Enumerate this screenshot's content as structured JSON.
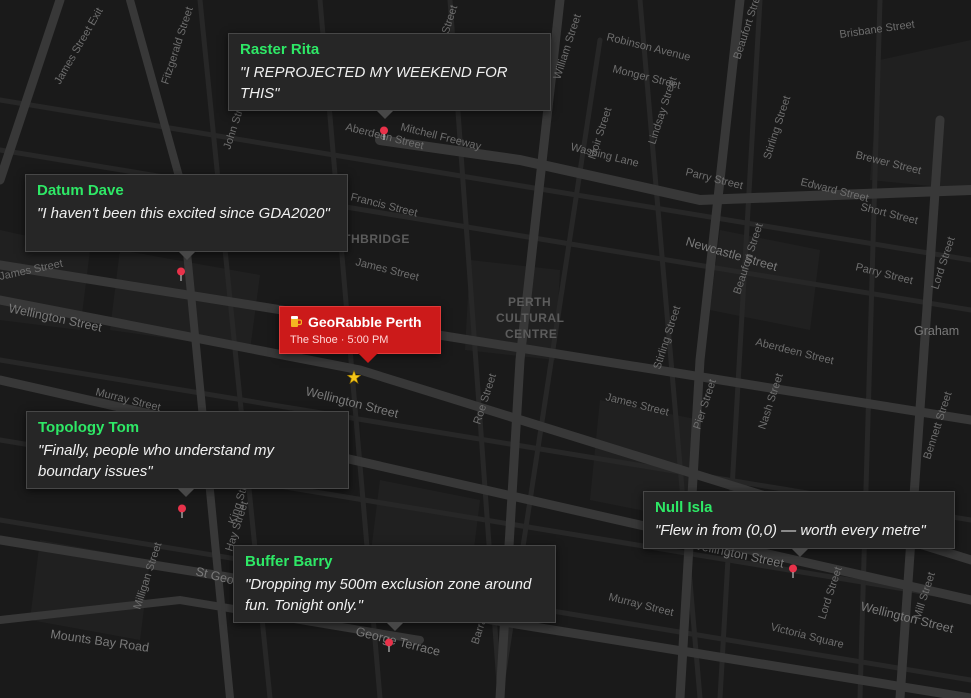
{
  "map": {
    "districts": [
      "NORTHBRIDGE",
      "PERTH",
      "CULTURAL",
      "CENTRE"
    ],
    "streets": {
      "wellington_w": "Wellington Street",
      "wellington_c": "Wellington Street",
      "wellington_e": "Wellington Street",
      "wellington_far_e": "Wellington Street",
      "james_w": "James Street",
      "james_c": "James Street",
      "james_e": "James Street",
      "newcastle": "Newcastle Street",
      "aberdeen": "Aberdeen Street",
      "francis": "Francis Street",
      "murray_w": "Murray Street",
      "murray_e": "Murray Street",
      "st_georges": "St Georges",
      "george_terrace": "George Terrace",
      "mounts_bay": "Mounts Bay Road",
      "mitchell_fwy": "Mitchell Freeway",
      "graham": "Graham",
      "lord_n": "Lord Street",
      "lord_s": "Lord Street",
      "mill": "Mill Street",
      "william": "William Street",
      "beaufort": "Beaufort Street",
      "stirling": "Stirling Street",
      "fitzgerald": "Fitzgerald Street",
      "brisbane": "Brisbane Street",
      "parry": "Parry Street",
      "roe": "Roe Street",
      "hay": "Hay Street",
      "barrack": "Barrack Street",
      "king": "King Street",
      "milligan": "Milligan Street",
      "pier": "Pier Street",
      "nash": "Nash Street",
      "bennett": "Bennett Street",
      "victoria_square": "Victoria Square",
      "james_exit": "James Street Exit",
      "lake": "Lake Street",
      "washing": "Washing Lane",
      "robinson": "Robinson Avenue",
      "monger": "Monger Street",
      "edward": "Edward Street",
      "brewer": "Brewer Street",
      "short": "Short Street",
      "aberdeen_e": "Aberdeen Street",
      "john": "John Street",
      "lindsay": "Lindsay Street",
      "moir": "Moir Street"
    }
  },
  "event": {
    "title": "GeoRabble Perth",
    "subtitle": "The Shoe · 5:00 PM",
    "icon": "beer-mug-icon",
    "color": "#cc1a1a"
  },
  "attendees": [
    {
      "name": "Raster Rita",
      "quote": "\"I REPROJECTED MY WEEKEND FOR THIS\""
    },
    {
      "name": "Datum Dave",
      "quote": "\"I haven't been this excited since GDA2020\""
    },
    {
      "name": "Topology Tom",
      "quote": "\"Finally, people who understand my boundary issues\""
    },
    {
      "name": "Buffer Barry",
      "quote": "\"Dropping my 500m exclusion zone around fun. Tonight only.\""
    },
    {
      "name": "Null Isla",
      "quote": "\"Flew in from (0,0) — worth every metre\""
    }
  ],
  "colors": {
    "background": "#1a1a1a",
    "attendee_name": "#2ee866",
    "pin": "#e8324a",
    "star": "#f5c518"
  }
}
